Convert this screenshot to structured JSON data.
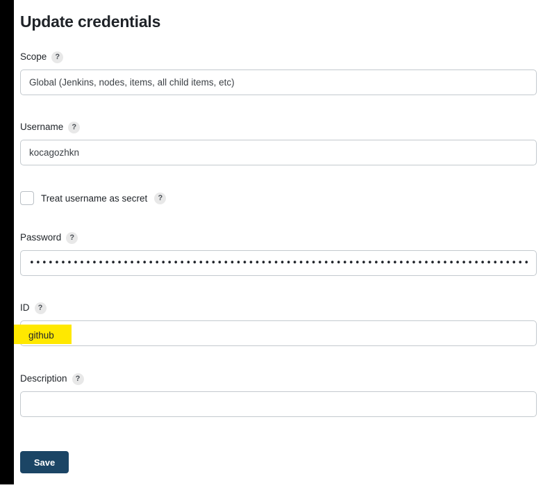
{
  "page": {
    "title": "Update credentials",
    "background_color": "#ffffff",
    "gutter_color": "#000000"
  },
  "help_icon_glyph": "?",
  "fields": {
    "scope": {
      "label": "Scope",
      "help_glyph": "?",
      "value": "Global (Jenkins, nodes, items, all child items, etc)"
    },
    "username": {
      "label": "Username",
      "help_glyph": "?",
      "value": "kocagozhkn",
      "placeholder": ""
    },
    "treat_username_as_secret": {
      "label": "Treat username as secret",
      "help_glyph": "?",
      "checked": false
    },
    "password": {
      "label": "Password",
      "help_glyph": "?",
      "masked_value": "•••••••••••••••••••••••••••••••••••••••••••••••••••••••••••••••••••••••••••••••••••••••••••••••",
      "masked_char_count": 95
    },
    "id": {
      "label": "ID",
      "help_glyph": "?",
      "value": "github",
      "highlighted": true,
      "highlight_color": "#ffe800"
    },
    "description": {
      "label": "Description",
      "help_glyph": "?",
      "value": "",
      "placeholder": ""
    }
  },
  "actions": {
    "save": {
      "label": "Save",
      "color": "#1b4565",
      "text_color": "#ffffff"
    }
  }
}
